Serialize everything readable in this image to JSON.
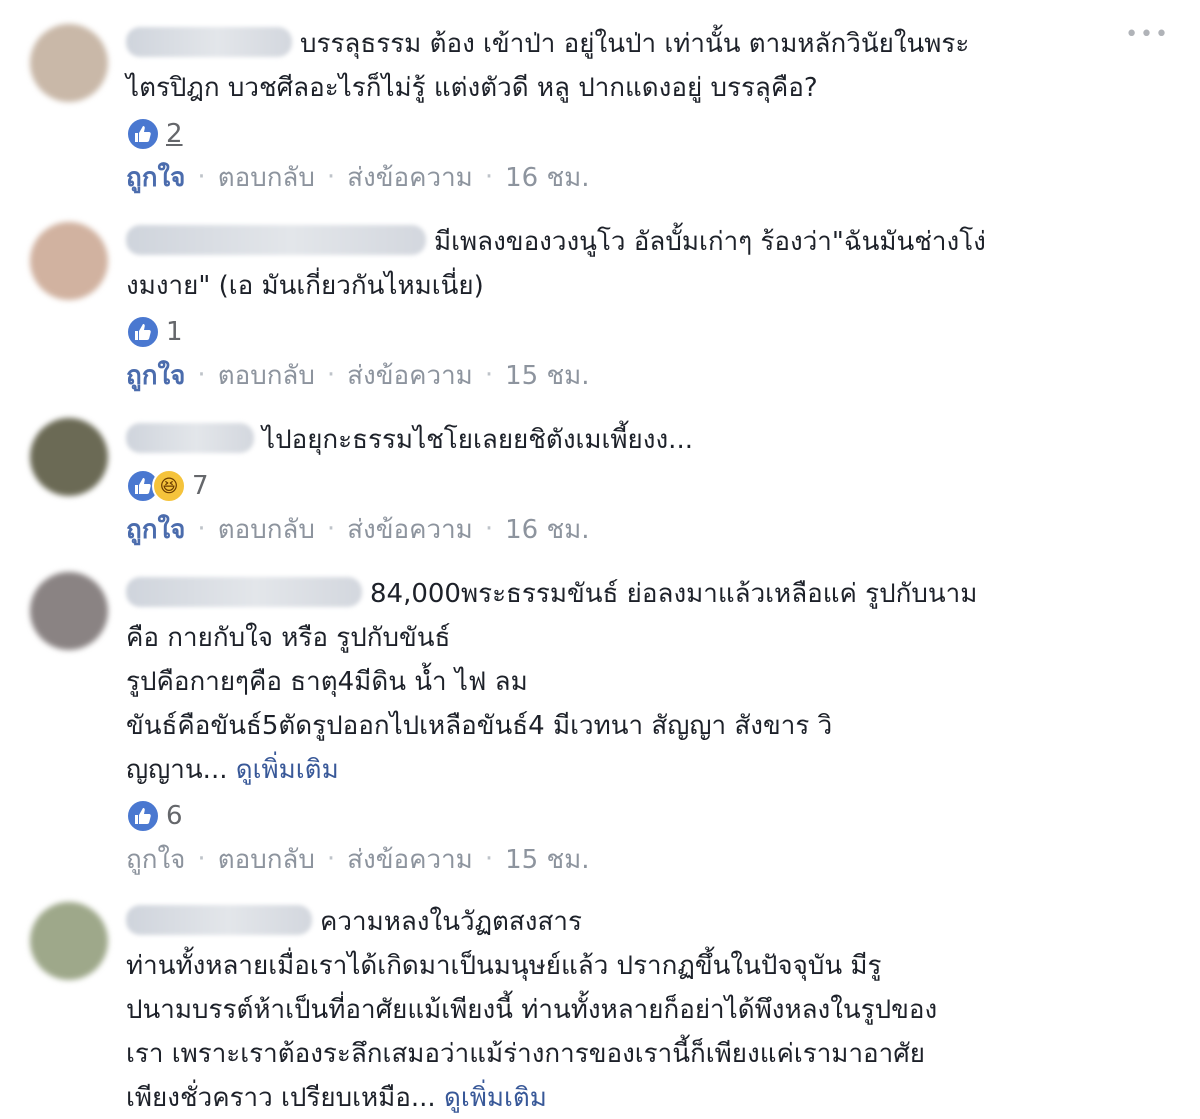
{
  "more_icon": "•••",
  "comments": [
    {
      "avatar_color": "#c9b8a8",
      "text": "บรรลุธรรม ต้อง เข้าป่า อยู่ในป่า เท่านั้น ตามหลักวินัยในพระ\nไตรปิฎก บวชศีลอะไรก็ไม่รู้ แต่งตัวดี หลู ปากแดงอยู่ บรรลุคือ?",
      "reactions": {
        "like_icon": "thumbs-up",
        "count": "2"
      },
      "actions": {
        "like": "ถูกใจ",
        "reply": "ตอบกลับ",
        "message": "ส่งข้อความ",
        "time": "16 ชม."
      }
    },
    {
      "avatar_color": "#d1b2a0",
      "text": "มีเพลงของวงนูโว อัลบั้มเก่าๆ ร้องว่า\"ฉันมันช่างโง่\nงมงาย\" (เอ มันเกี่ยวกันไหมเนี่ย)",
      "reactions": {
        "like_icon": "thumbs-up",
        "count": "1"
      },
      "actions": {
        "like": "ถูกใจ",
        "reply": "ตอบกลับ",
        "message": "ส่งข้อความ",
        "time": "15 ชม."
      }
    },
    {
      "avatar_color": "#6b6a55",
      "text": "ไปอยุกะธรรมไชโยเลยยชิตังเมเพี้ยงง...",
      "reactions": {
        "like_icon": "thumbs-up",
        "haha_icon": "haha-face",
        "count": "7"
      },
      "actions": {
        "like": "ถูกใจ",
        "reply": "ตอบกลับ",
        "message": "ส่งข้อความ",
        "time": "16 ชม."
      }
    },
    {
      "avatar_color": "#8a8383",
      "text": "84,000พระธรรมขันธ์ ย่อลงมาแล้วเหลือแค่ รูปกับนาม\nคือ กายกับใจ หรือ รูปกับขันธ์\nรูปคือกายๆคือ ธาตุ4มีดิน น้ำ ไฟ ลม\nขันธ์คือขันธ์5ตัดรูปออกไปเหลือขันธ์4 มีเวทนา สัญญา สังขาร วิ\nญญาน...",
      "see_more": "ดูเพิ่มเติม",
      "reactions": {
        "like_icon": "thumbs-up",
        "count": "6"
      },
      "actions": {
        "like": "ถูกใจ",
        "reply": "ตอบกลับ",
        "message": "ส่งข้อความ",
        "time": "15 ชม."
      }
    },
    {
      "avatar_color": "#9ea88a",
      "text": "ความหลงในวัฏตสงสาร\nท่านทั้งหลายเมื่อเราได้เกิดมาเป็นมนุษย์แล้ว ปรากฏขึ้นในปัจจุบัน มีรู\nปนามบรรต์ห้าเป็นที่อาศัยแม้เพียงนี้ ท่านทั้งหลายก็อย่าได้พึงหลงในรูปของ\nเรา เพราะเราต้องระลึกเสมอว่าแม้ร่างการของเรานี้ก็เพียงแค่เรามาอาศัย\nเพียงชั่วคราว เปรียบเหมือ...",
      "see_more": "ดูเพิ่มเติม"
    }
  ]
}
